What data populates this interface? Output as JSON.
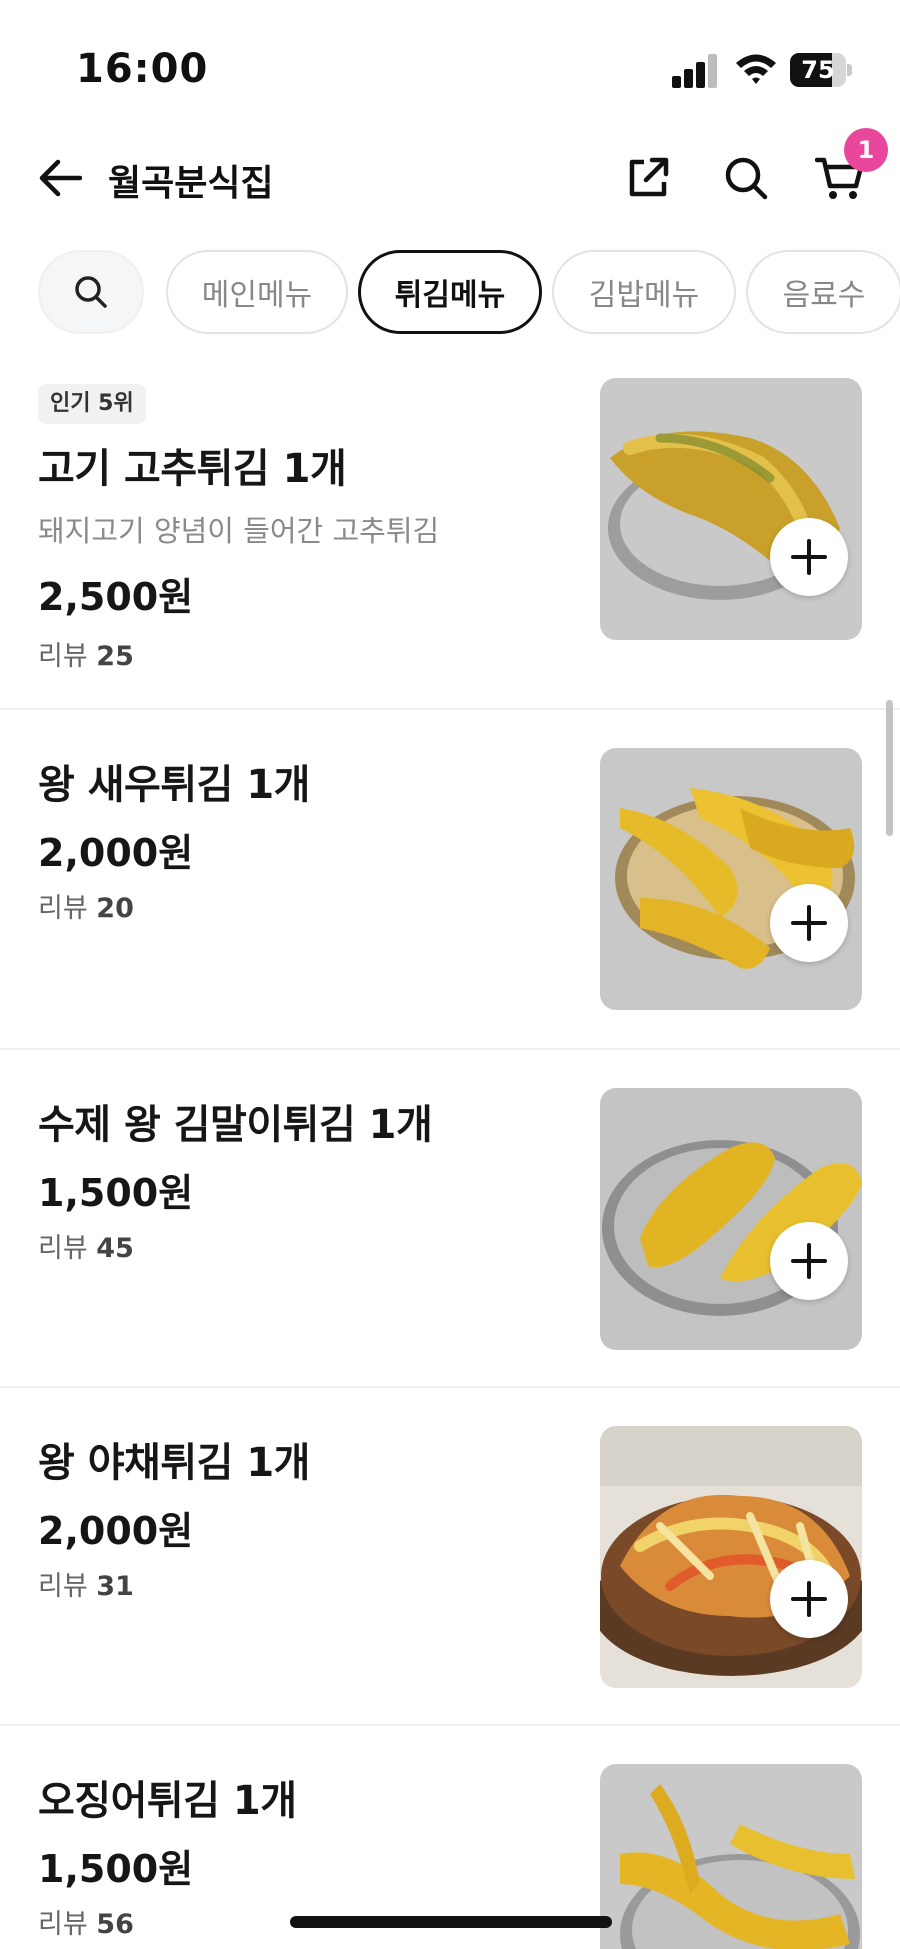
{
  "status_bar": {
    "time": "16:00",
    "battery": "75",
    "battery_level": 0.75
  },
  "header": {
    "title": "월곡분식집",
    "back_icon": "arrow-left-icon",
    "share_icon": "share-icon",
    "search_icon": "search-icon",
    "cart_icon": "cart-icon",
    "cart_count": "1"
  },
  "categories": {
    "search_icon": "search-icon",
    "items": [
      {
        "label": "메인메뉴",
        "active": false
      },
      {
        "label": "튀김메뉴",
        "active": true
      },
      {
        "label": "김밥메뉴",
        "active": false
      },
      {
        "label": "음료수",
        "active": false
      }
    ]
  },
  "menu": {
    "items": [
      {
        "badge": "인기 5위",
        "name": "고기 고추튀김 1개",
        "description": "돼지고기 양념이 들어간 고추튀김",
        "price": "2,500원",
        "review_label": "리뷰",
        "review_count": "25"
      },
      {
        "name": "왕 새우튀김 1개",
        "price": "2,000원",
        "review_label": "리뷰",
        "review_count": "20"
      },
      {
        "name": "수제 왕 김말이튀김 1개",
        "price": "1,500원",
        "review_label": "리뷰",
        "review_count": "45"
      },
      {
        "name": "왕 야채튀김 1개",
        "price": "2,000원",
        "review_label": "리뷰",
        "review_count": "31"
      },
      {
        "name": "오징어튀김 1개",
        "price": "1,500원",
        "review_label": "리뷰",
        "review_count": "56"
      }
    ]
  },
  "colors": {
    "accent_badge": "#e8479b",
    "text_primary": "#161616",
    "text_secondary": "#8a8a8a"
  }
}
